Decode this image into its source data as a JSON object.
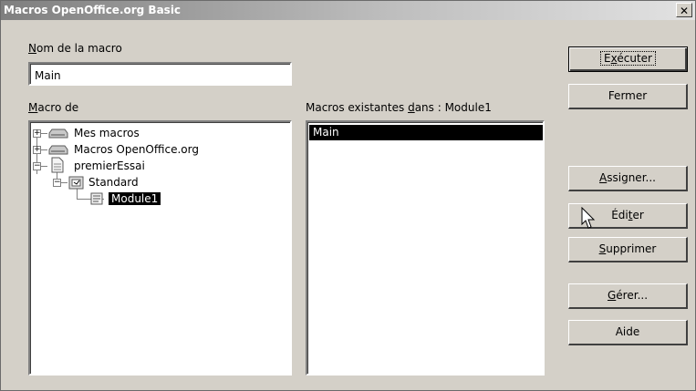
{
  "window": {
    "title": "Macros OpenOffice.org Basic",
    "close_glyph": "✕"
  },
  "macro_name": {
    "label_underlined": "N",
    "label_rest": "om de la macro",
    "value": "Main"
  },
  "macro_from": {
    "label_underlined": "M",
    "label_rest": "acro de"
  },
  "existing": {
    "label_before": "Macros existantes ",
    "label_underlined": "d",
    "label_after": "ans : Module1"
  },
  "tree": [
    {
      "label": "Mes macros",
      "icon": "drive-icon",
      "expander": "+"
    },
    {
      "label": "Macros OpenOffice.org",
      "icon": "drive-icon",
      "expander": "+"
    },
    {
      "label": "premierEssai",
      "icon": "document-icon",
      "expander": "−"
    },
    {
      "label": "Standard",
      "icon": "library-icon",
      "expander": "−"
    },
    {
      "label": "Module1",
      "icon": "module-icon",
      "selected": true
    }
  ],
  "macros_list": [
    "Main"
  ],
  "buttons": {
    "execute": {
      "pre": "E",
      "u": "x",
      "post": "écuter"
    },
    "close": {
      "pre": "",
      "u": "",
      "post": "Fermer"
    },
    "assign": {
      "pre": "",
      "u": "A",
      "post": "ssigner..."
    },
    "edit": {
      "pre": "Édi",
      "u": "t",
      "post": "er"
    },
    "delete": {
      "pre": "",
      "u": "S",
      "post": "upprimer"
    },
    "manage": {
      "pre": "",
      "u": "G",
      "post": "érer..."
    },
    "help": {
      "pre": "",
      "u": "",
      "post": "Aide"
    }
  },
  "colors": {
    "face": "#d4d0c8",
    "selection": "#000000",
    "title_gradient_start": "#7f7f7f"
  }
}
